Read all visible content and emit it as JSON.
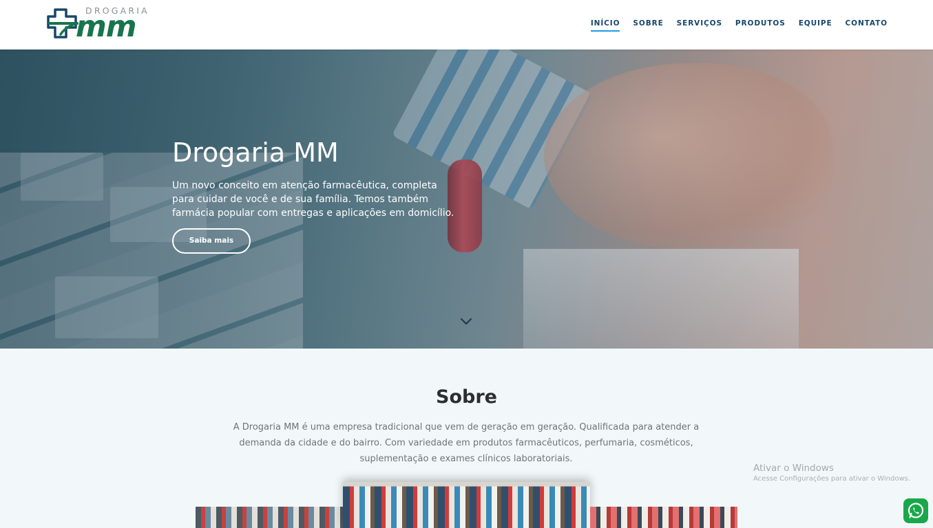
{
  "brand": {
    "logo_top": "DROGARIA",
    "logo_main": "mm",
    "colors": {
      "primary_green": "#17754d",
      "navy": "#15476b",
      "accent_blue": "#1a9fe0"
    }
  },
  "nav": {
    "items": [
      {
        "label": "INÍCIO",
        "active": true
      },
      {
        "label": "SOBRE",
        "active": false
      },
      {
        "label": "SERVIÇOS",
        "active": false
      },
      {
        "label": "PRODUTOS",
        "active": false
      },
      {
        "label": "EQUIPE",
        "active": false
      },
      {
        "label": "CONTATO",
        "active": false
      }
    ]
  },
  "hero": {
    "title": "Drogaria MM",
    "text": "Um novo conceito em atenção farmacêutica, completa para cuidar de você e de sua família. Temos também farmácia popular com entregas e aplicações em domicílio.",
    "button_label": "Saiba mais",
    "scroll_icon": "chevron-down-icon"
  },
  "sobre": {
    "title": "Sobre",
    "text": "A Drogaria MM é uma empresa tradicional que vem de geração em geração. Qualificada para atender a demanda da cidade e do bairro. Com variedade em produtos farmacêuticos, perfumaria, cosméticos, suplementação e exames clínicos laboratoriais."
  },
  "watermark": {
    "title": "Ativar o Windows",
    "subtitle": "Acesse Configurações para ativar o Windows."
  },
  "floating": {
    "whatsapp_icon": "whatsapp-icon",
    "whatsapp_color": "#18a84a"
  }
}
